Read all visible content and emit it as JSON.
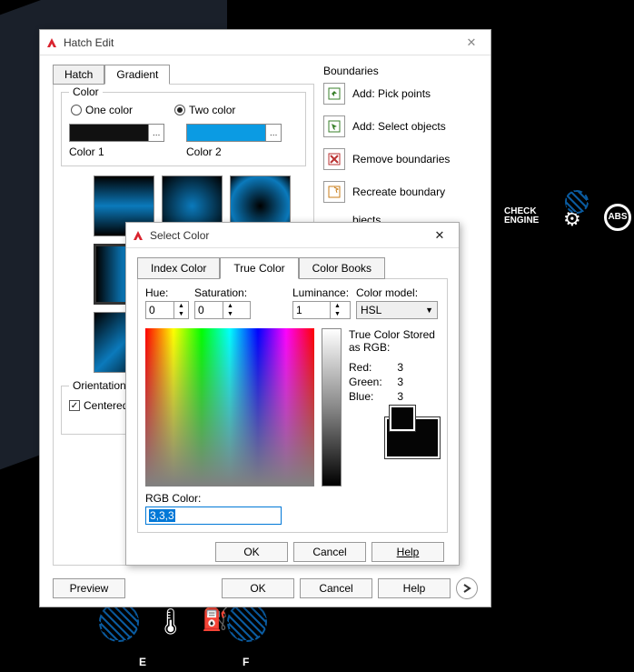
{
  "background": {
    "check_engine_line1": "CHECK",
    "check_engine_line2": "ENGINE",
    "e": "E",
    "f": "F"
  },
  "hatch": {
    "title": "Hatch Edit",
    "tabs": {
      "hatch": "Hatch",
      "gradient": "Gradient"
    },
    "color": {
      "legend": "Color",
      "one": "One color",
      "two": "Two color",
      "color1": "Color 1",
      "color2": "Color 2"
    },
    "orientation": {
      "legend": "Orientation",
      "centered": "Centered"
    },
    "boundaries": {
      "head": "Boundaries",
      "pick": "Add: Pick points",
      "select": "Add: Select objects",
      "remove": "Remove boundaries",
      "recreate": "Recreate boundary",
      "view": "bjects"
    },
    "footer": {
      "preview": "Preview",
      "ok": "OK",
      "cancel": "Cancel",
      "help": "Help"
    }
  },
  "color_dialog": {
    "title": "Select Color",
    "tabs": {
      "index": "Index Color",
      "true": "True Color",
      "books": "Color Books"
    },
    "hsl": {
      "hue": "Hue:",
      "hue_val": "0",
      "sat": "Saturation:",
      "sat_val": "0",
      "lum": "Luminance:",
      "lum_val": "1"
    },
    "model": {
      "label": "Color model:",
      "value": "HSL"
    },
    "stored": {
      "head1": "True Color Stored",
      "head2": "as RGB:",
      "red": "Red:",
      "red_v": "3",
      "green": "Green:",
      "green_v": "3",
      "blue": "Blue:",
      "blue_v": "3"
    },
    "rgb": {
      "label": "RGB Color:",
      "value": "3,3,3"
    },
    "footer": {
      "ok": "OK",
      "cancel": "Cancel",
      "help": "Help"
    }
  }
}
